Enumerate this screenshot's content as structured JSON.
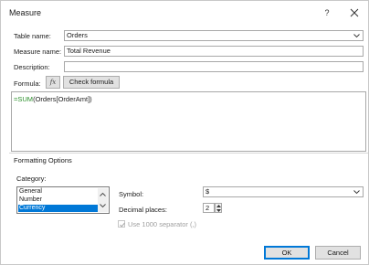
{
  "dialog": {
    "title": "Measure",
    "help_label": "?",
    "table_name_label": "Table name:",
    "table_name_value": "Orders",
    "measure_name_label": "Measure name:",
    "measure_name_value": "Total Revenue",
    "description_label": "Description:",
    "description_value": "",
    "formula_label": "Formula:",
    "fx_label": "fx",
    "check_formula_label": "Check formula",
    "formula_tokens": {
      "eq": "=",
      "fn": "SUM",
      "open": "(",
      "ref": "Orders[OrderAmt]",
      "close": ")"
    }
  },
  "formatting": {
    "section_title": "Formatting Options",
    "category_label": "Category:",
    "categories": [
      "General",
      "Number",
      "Currency"
    ],
    "selected_category": "Currency",
    "symbol_label": "Symbol:",
    "symbol_value": "$",
    "decimal_label": "Decimal places:",
    "decimal_value": "2",
    "separator_label": "Use 1000 separator (,)",
    "separator_checked": true,
    "separator_enabled": false
  },
  "buttons": {
    "ok": "OK",
    "cancel": "Cancel"
  },
  "colors": {
    "selection": "#0078d7",
    "formula_function": "#2a8f2a"
  }
}
